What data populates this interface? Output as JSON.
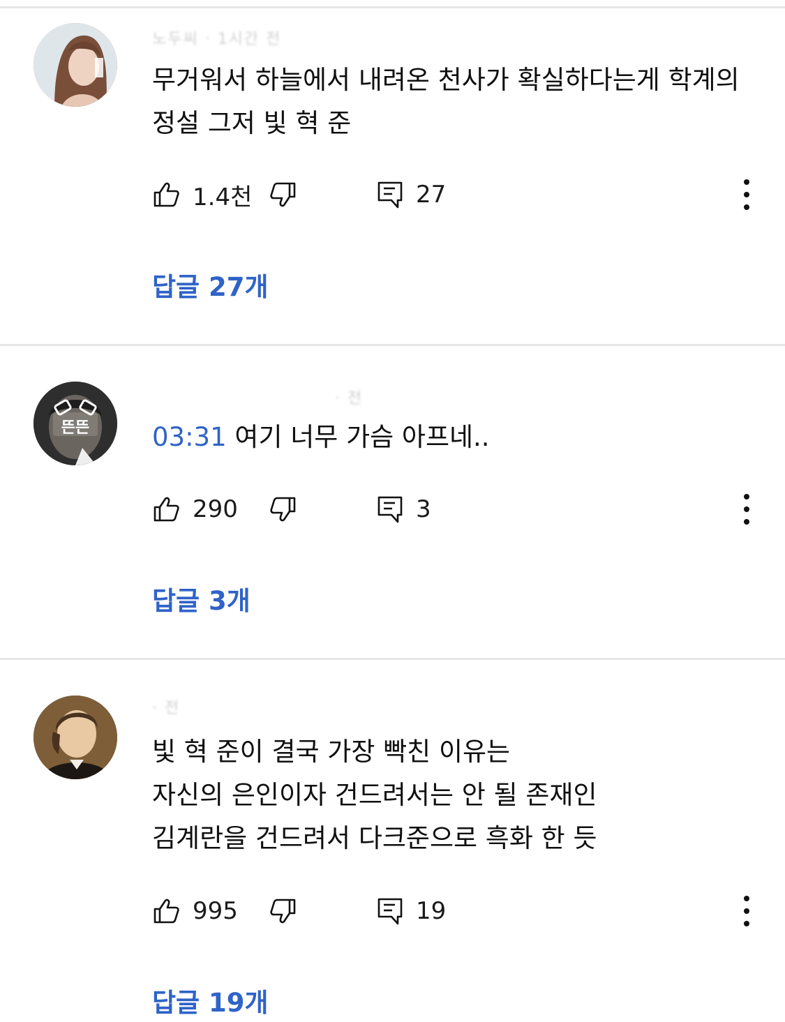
{
  "colors": {
    "link": "#2f63c8",
    "divider": "#e6e6e6",
    "text": "#0f0f0f"
  },
  "comments": [
    {
      "author_meta": "노두씨 · 1시간 전",
      "text": "무거워서 하늘에서 내려온 천사가 확실하다는게 학계의 정설 그저 빛 혁 준",
      "timestamp": "",
      "likes": "1.4천",
      "reply_count": "27",
      "replies_label": "답글 27개",
      "avatar_icon": "woman-portrait"
    },
    {
      "author_meta": "· 전",
      "text": "여기 너무 가슴 아프네..",
      "timestamp": "03:31",
      "likes": "290",
      "reply_count": "3",
      "replies_label": "답글 3개",
      "avatar_icon": "ddun-ddun-avatar",
      "avatar_text": "뜬뜬"
    },
    {
      "author_meta": "· 전",
      "text_lines": [
        "빛 혁 준이 결국 가장 빡친 이유는",
        "자신의 은인이자 건드려서는 안 될 존재인",
        "김계란을 건드려서 다크준으로 흑화 한 듯"
      ],
      "likes": "995",
      "reply_count": "19",
      "replies_label": "답글 19개",
      "avatar_icon": "chopin-portrait"
    }
  ]
}
